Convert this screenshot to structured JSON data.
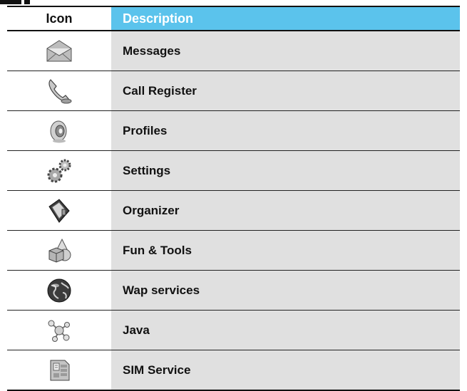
{
  "table": {
    "header": {
      "icon": "Icon",
      "description": "Description"
    },
    "rows": [
      {
        "icon": "envelope-icon",
        "description": "Messages"
      },
      {
        "icon": "phone-handset-icon",
        "description": "Call Register"
      },
      {
        "icon": "speaker-icon",
        "description": "Profiles"
      },
      {
        "icon": "gears-icon",
        "description": "Settings"
      },
      {
        "icon": "organizer-book-icon",
        "description": "Organizer"
      },
      {
        "icon": "shapes-icon",
        "description": "Fun & Tools"
      },
      {
        "icon": "globe-icon",
        "description": "Wap services"
      },
      {
        "icon": "java-molecule-icon",
        "description": "Java"
      },
      {
        "icon": "sim-card-icon",
        "description": "SIM Service"
      }
    ]
  },
  "colors": {
    "header_accent": "#5bc3ec",
    "description_cell": "#e0e0e0"
  }
}
